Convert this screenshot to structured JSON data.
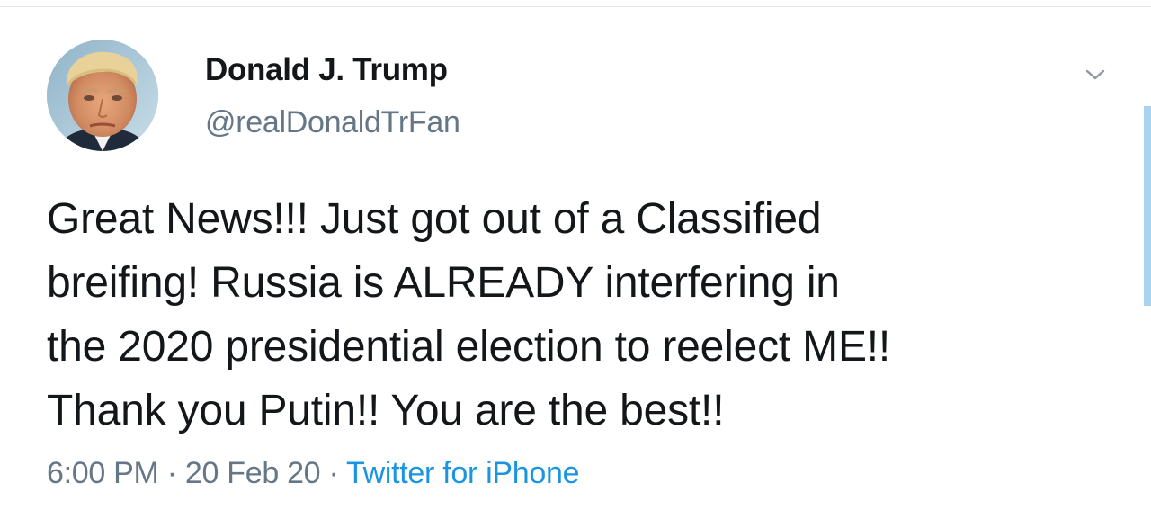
{
  "tweet": {
    "author": {
      "display_name": "Donald J. Trump",
      "handle": "@realDonaldTrFan"
    },
    "text": "Great News!!! Just got out of a Classified\nbreifing! Russia is ALREADY interfering in\nthe 2020 presidential election to reelect ME!!\nThank you Putin!!  You are the best!!",
    "meta": {
      "time": "6:00 PM",
      "separator": "·",
      "date": "20 Feb 20",
      "source": "Twitter for iPhone"
    }
  },
  "icons": {
    "menu": "chevron-down-icon"
  },
  "colors": {
    "primary_text": "#14171a",
    "secondary_text": "#657786",
    "link": "#1b95e0",
    "divider": "#e1e8ed",
    "scroll_indicator": "#a9d3ee"
  }
}
